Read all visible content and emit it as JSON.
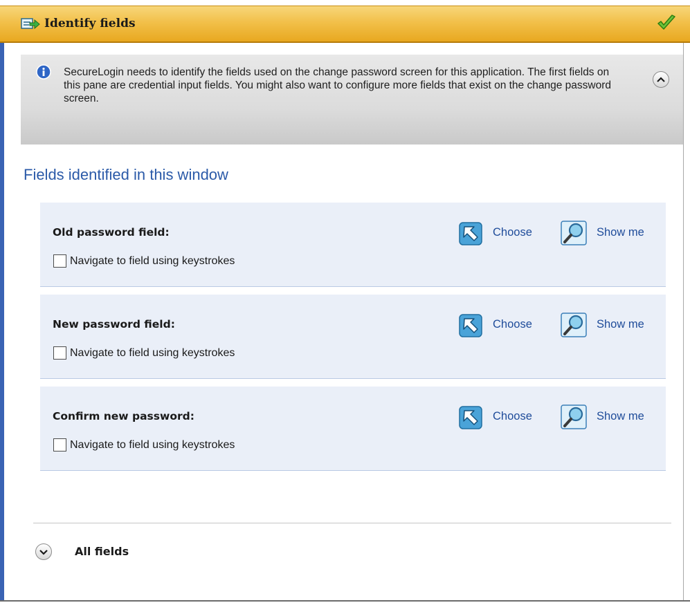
{
  "header": {
    "title": "Identify fields",
    "icon": "identify-fields-icon",
    "status_icon": "check-icon",
    "colors": {
      "bar": "#f2c04a",
      "check": "#5cbf2a"
    }
  },
  "info": {
    "icon": "info-icon",
    "text": "SecureLogin needs to identify the fields used on the change password screen for this application. The first fields on this pane are credential input fields. You might also want to configure more fields that exist on the change password screen.",
    "collapse_icon": "chevron-up-icon"
  },
  "section": {
    "title": "Fields identified in this window",
    "fields": [
      {
        "label": "Old password field:",
        "navigate_label": "Navigate to field using keystrokes",
        "navigate_checked": false,
        "choose_label": "Choose",
        "show_label": "Show me"
      },
      {
        "label": "New password field:",
        "navigate_label": "Navigate to field using keystrokes",
        "navigate_checked": false,
        "choose_label": "Choose",
        "show_label": "Show me"
      },
      {
        "label": "Confirm new password:",
        "navigate_label": "Navigate to field using keystrokes",
        "navigate_checked": false,
        "choose_label": "Choose",
        "show_label": "Show me"
      }
    ]
  },
  "all_fields": {
    "label": "All fields",
    "expand_icon": "chevron-down-icon"
  },
  "colors": {
    "accent": "#2b5aa8",
    "link": "#1f4c9a",
    "row_bg": "#eaeff8"
  }
}
